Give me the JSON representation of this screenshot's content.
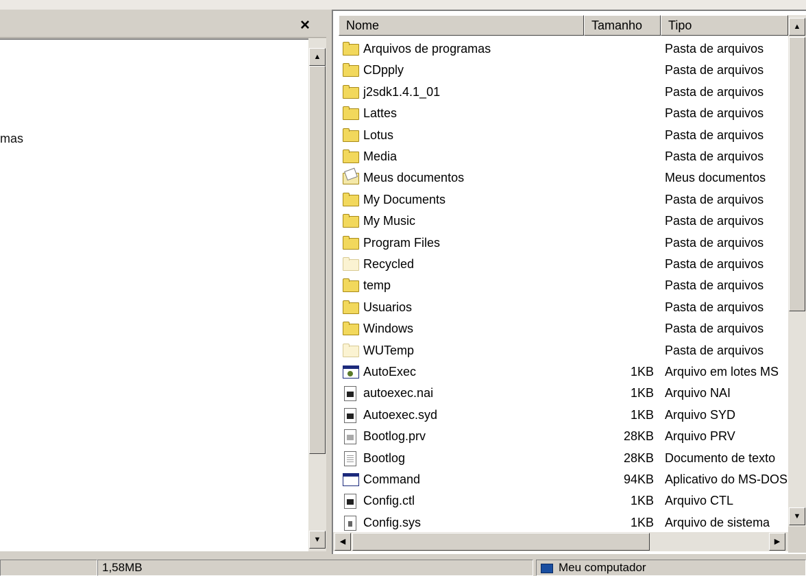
{
  "left_pane": {
    "close_glyph": "×",
    "tree_partial_label": "mas"
  },
  "columns": {
    "name": "Nome",
    "size": "Tamanho",
    "type": "Tipo"
  },
  "files": [
    {
      "name": "Arquivos de programas",
      "size": "",
      "type": "Pasta de arquivos",
      "icon": "folder-icon"
    },
    {
      "name": "CDpply",
      "size": "",
      "type": "Pasta de arquivos",
      "icon": "folder-icon"
    },
    {
      "name": "j2sdk1.4.1_01",
      "size": "",
      "type": "Pasta de arquivos",
      "icon": "folder-icon"
    },
    {
      "name": "Lattes",
      "size": "",
      "type": "Pasta de arquivos",
      "icon": "folder-icon"
    },
    {
      "name": "Lotus",
      "size": "",
      "type": "Pasta de arquivos",
      "icon": "folder-icon"
    },
    {
      "name": "Media",
      "size": "",
      "type": "Pasta de arquivos",
      "icon": "folder-icon"
    },
    {
      "name": "Meus documentos",
      "size": "",
      "type": "Meus documentos",
      "icon": "my-documents-icon"
    },
    {
      "name": "My Documents",
      "size": "",
      "type": "Pasta de arquivos",
      "icon": "folder-icon"
    },
    {
      "name": "My Music",
      "size": "",
      "type": "Pasta de arquivos",
      "icon": "folder-icon"
    },
    {
      "name": "Program Files",
      "size": "",
      "type": "Pasta de arquivos",
      "icon": "folder-icon"
    },
    {
      "name": "Recycled",
      "size": "",
      "type": "Pasta de arquivos",
      "icon": "hidden-folder-icon"
    },
    {
      "name": "temp",
      "size": "",
      "type": "Pasta de arquivos",
      "icon": "folder-icon"
    },
    {
      "name": "Usuarios",
      "size": "",
      "type": "Pasta de arquivos",
      "icon": "folder-icon"
    },
    {
      "name": "Windows",
      "size": "",
      "type": "Pasta de arquivos",
      "icon": "folder-icon"
    },
    {
      "name": "WUTemp",
      "size": "",
      "type": "Pasta de arquivos",
      "icon": "hidden-folder-icon"
    },
    {
      "name": "AutoExec",
      "size": "1KB",
      "type": "Arquivo em lotes MS",
      "icon": "batch-file-icon"
    },
    {
      "name": "autoexec.nai",
      "size": "1KB",
      "type": "Arquivo NAI",
      "icon": "system-file-icon"
    },
    {
      "name": "Autoexec.syd",
      "size": "1KB",
      "type": "Arquivo SYD",
      "icon": "system-file-icon"
    },
    {
      "name": "Bootlog.prv",
      "size": "28KB",
      "type": "Arquivo PRV",
      "icon": "faded-file-icon"
    },
    {
      "name": "Bootlog",
      "size": "28KB",
      "type": "Documento de texto",
      "icon": "text-file-icon"
    },
    {
      "name": "Command",
      "size": "94KB",
      "type": "Aplicativo do MS-DOS",
      "icon": "dos-app-icon"
    },
    {
      "name": "Config.ctl",
      "size": "1KB",
      "type": "Arquivo CTL",
      "icon": "system-file-icon"
    },
    {
      "name": "Config.sys",
      "size": "1KB",
      "type": "Arquivo de sistema",
      "icon": "config-file-icon"
    }
  ],
  "status_bar": {
    "size_text": "1,58MB",
    "location_text": "Meu computador"
  },
  "scrollbar_glyphs": {
    "up": "▲",
    "down": "▼",
    "left": "◀",
    "right": "▶"
  }
}
